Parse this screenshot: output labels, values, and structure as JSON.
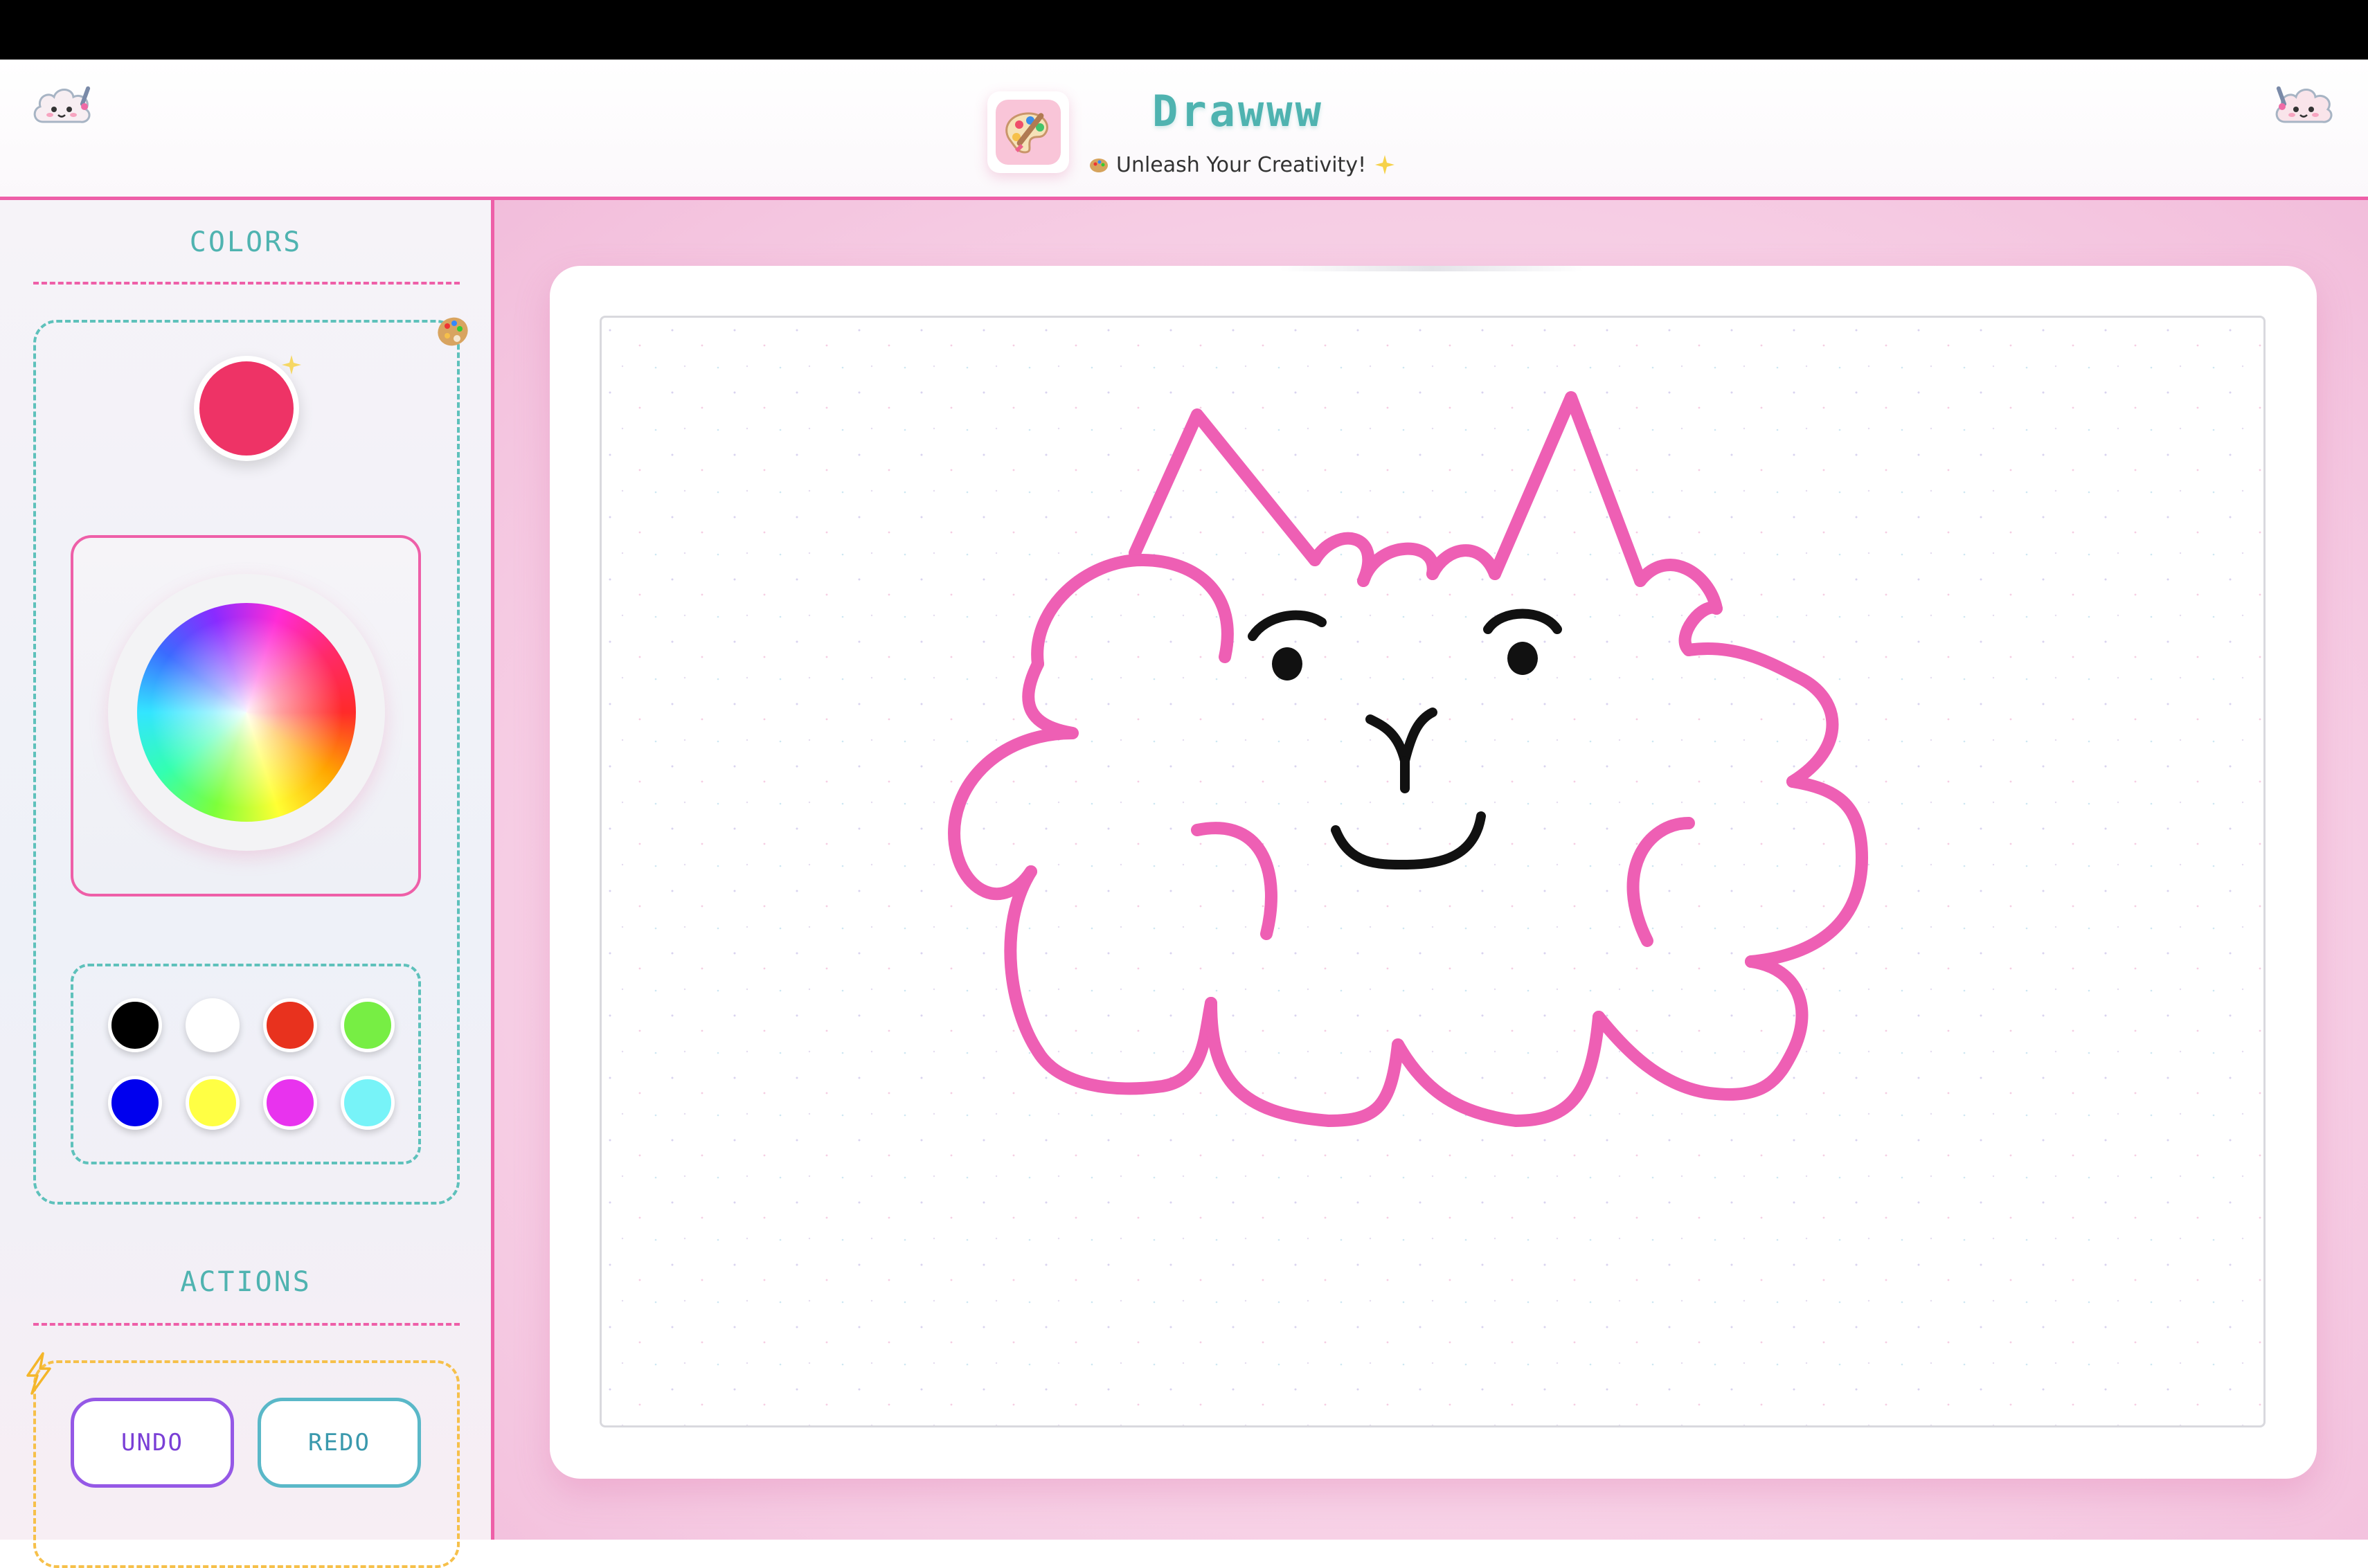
{
  "header": {
    "app_title": "Drawww",
    "tagline": "Unleash Your Creativity!"
  },
  "sidebar": {
    "colors_title": "COLORS",
    "current_color": "#ee3366",
    "palette": [
      {
        "name": "black",
        "hex": "#000000"
      },
      {
        "name": "white",
        "hex": "#ffffff"
      },
      {
        "name": "red",
        "hex": "#e8321e"
      },
      {
        "name": "green",
        "hex": "#77ee44"
      },
      {
        "name": "blue",
        "hex": "#0000ee"
      },
      {
        "name": "yellow",
        "hex": "#ffff44"
      },
      {
        "name": "magenta",
        "hex": "#e833ee"
      },
      {
        "name": "cyan",
        "hex": "#77f3f8"
      }
    ],
    "actions_title": "ACTIONS",
    "undo_label": "UNDO",
    "redo_label": "REDO"
  },
  "canvas": {
    "drawing_colors": {
      "cloud_outline": "#ee5fb4",
      "face": "#111111"
    }
  },
  "theme": {
    "accent_pink": "#ee5fa8",
    "accent_teal": "#4fb3b0",
    "accent_purple": "#9558e6",
    "accent_yellow": "#f6c04a"
  }
}
